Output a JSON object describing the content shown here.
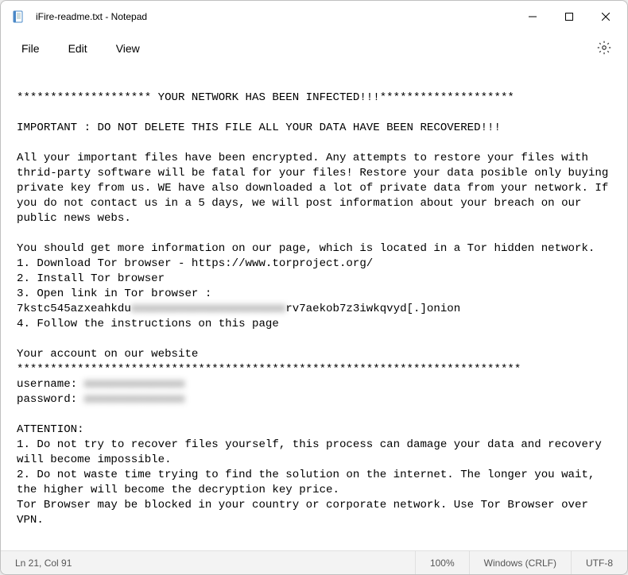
{
  "titlebar": {
    "title": "iFire-readme.txt - Notepad"
  },
  "menu": {
    "file": "File",
    "edit": "Edit",
    "view": "View"
  },
  "content": {
    "line1": "******************** YOUR NETWORK HAS BEEN INFECTED!!!********************",
    "blank1": "",
    "line2": "IMPORTANT : DO NOT DELETE THIS FILE ALL YOUR DATA HAVE BEEN RECOVERED!!!",
    "blank2": "",
    "para1": "All your important files have been encrypted. Any attempts to restore your files with thrid-party software will be fatal for your files! Restore your data posible only buying private key from us. WE have also downloaded a lot of private data from your network. If you do not contact us in a 5 days, we will post information about your breach on our public news webs.",
    "blank3": "",
    "para2a": "You should get more information on our page, which is located in a Tor hidden network.",
    "step1": "1. Download Tor browser - https://www.torproject.org/",
    "step2": "2. Install Tor browser",
    "step3": "3. Open link in Tor browser :",
    "onion_prefix": "7kstc545azxeahkdu",
    "onion_mid_blur": "xxxxxxxxxxxxxxxxxxxxxxx",
    "onion_suffix": "rv7aekob7z3iwkqvyd[.]onion",
    "step4": "4. Follow the instructions on this page",
    "blank4": "",
    "acct_header": "Your account on our website",
    "acct_sep": "***************************************************************************",
    "user_label": "username: ",
    "user_blur": "xxxxxxxxxxxxxxx",
    "pass_label": "password: ",
    "pass_blur": "xxxxxxxxxxxxxxx",
    "blank5": "",
    "attn": "ATTENTION:",
    "attn1": "1. Do not try to recover files yourself, this process can damage your data and recovery will become impossible.",
    "attn2": "2. Do not waste time trying to find the solution on the internet. The longer you wait, the higher will become the decryption key price.",
    "attn3": "Tor Browser may be blocked in your country or corporate network. Use Tor Browser over VPN."
  },
  "status": {
    "position": "Ln 21, Col 91",
    "zoom": "100%",
    "eol": "Windows (CRLF)",
    "encoding": "UTF-8"
  }
}
